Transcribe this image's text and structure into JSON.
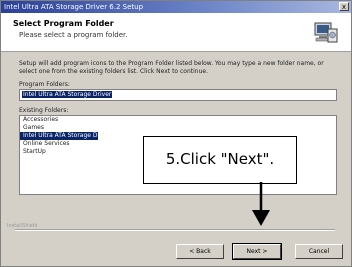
{
  "window": {
    "title": "Intel Ultra ATA Storage Driver 6.2 Setup",
    "close_glyph": "x"
  },
  "header": {
    "title": "Select Program Folder",
    "subtitle": "Please select a program folder.",
    "icon": "setup-computer-icon"
  },
  "body": {
    "description": "Setup will add program icons to the Program Folder listed below. You may type a new folder name, or select one from the existing folders list. Click Next to continue.",
    "program_folder_label": "Program Folders:",
    "program_folder_value": "Intel Ultra ATA Storage Driver",
    "existing_folders_label": "Existing Folders:",
    "existing_folders": [
      "Accessories",
      "Games",
      "Intel Ultra ATA Storage Driver",
      "Online Services",
      "StartUp"
    ],
    "selected_folder": "Intel Ultra ATA Storage Driver"
  },
  "annotation": {
    "callout_text": "5.Click \"Next\"."
  },
  "footer": {
    "brand": "InstallShield",
    "back_label": "< Back",
    "next_label": "Next >",
    "cancel_label": "Cancel"
  },
  "colors": {
    "titlebar_start": "#2a3f9a",
    "selection": "#0a246a",
    "dialog_bg": "#d4d0c8"
  }
}
